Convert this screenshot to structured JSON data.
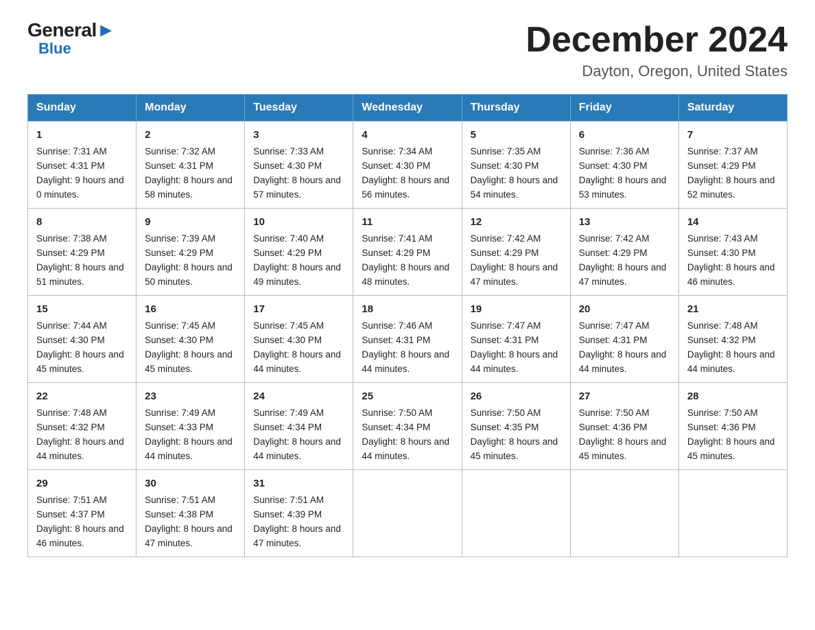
{
  "logo": {
    "general": "General",
    "blue": "Blue",
    "triangle": "▶"
  },
  "header": {
    "month_year": "December 2024",
    "location": "Dayton, Oregon, United States"
  },
  "days_of_week": [
    "Sunday",
    "Monday",
    "Tuesday",
    "Wednesday",
    "Thursday",
    "Friday",
    "Saturday"
  ],
  "weeks": [
    [
      {
        "day": "1",
        "sunrise": "7:31 AM",
        "sunset": "4:31 PM",
        "daylight": "9 hours and 0 minutes."
      },
      {
        "day": "2",
        "sunrise": "7:32 AM",
        "sunset": "4:31 PM",
        "daylight": "8 hours and 58 minutes."
      },
      {
        "day": "3",
        "sunrise": "7:33 AM",
        "sunset": "4:30 PM",
        "daylight": "8 hours and 57 minutes."
      },
      {
        "day": "4",
        "sunrise": "7:34 AM",
        "sunset": "4:30 PM",
        "daylight": "8 hours and 56 minutes."
      },
      {
        "day": "5",
        "sunrise": "7:35 AM",
        "sunset": "4:30 PM",
        "daylight": "8 hours and 54 minutes."
      },
      {
        "day": "6",
        "sunrise": "7:36 AM",
        "sunset": "4:30 PM",
        "daylight": "8 hours and 53 minutes."
      },
      {
        "day": "7",
        "sunrise": "7:37 AM",
        "sunset": "4:29 PM",
        "daylight": "8 hours and 52 minutes."
      }
    ],
    [
      {
        "day": "8",
        "sunrise": "7:38 AM",
        "sunset": "4:29 PM",
        "daylight": "8 hours and 51 minutes."
      },
      {
        "day": "9",
        "sunrise": "7:39 AM",
        "sunset": "4:29 PM",
        "daylight": "8 hours and 50 minutes."
      },
      {
        "day": "10",
        "sunrise": "7:40 AM",
        "sunset": "4:29 PM",
        "daylight": "8 hours and 49 minutes."
      },
      {
        "day": "11",
        "sunrise": "7:41 AM",
        "sunset": "4:29 PM",
        "daylight": "8 hours and 48 minutes."
      },
      {
        "day": "12",
        "sunrise": "7:42 AM",
        "sunset": "4:29 PM",
        "daylight": "8 hours and 47 minutes."
      },
      {
        "day": "13",
        "sunrise": "7:42 AM",
        "sunset": "4:29 PM",
        "daylight": "8 hours and 47 minutes."
      },
      {
        "day": "14",
        "sunrise": "7:43 AM",
        "sunset": "4:30 PM",
        "daylight": "8 hours and 46 minutes."
      }
    ],
    [
      {
        "day": "15",
        "sunrise": "7:44 AM",
        "sunset": "4:30 PM",
        "daylight": "8 hours and 45 minutes."
      },
      {
        "day": "16",
        "sunrise": "7:45 AM",
        "sunset": "4:30 PM",
        "daylight": "8 hours and 45 minutes."
      },
      {
        "day": "17",
        "sunrise": "7:45 AM",
        "sunset": "4:30 PM",
        "daylight": "8 hours and 44 minutes."
      },
      {
        "day": "18",
        "sunrise": "7:46 AM",
        "sunset": "4:31 PM",
        "daylight": "8 hours and 44 minutes."
      },
      {
        "day": "19",
        "sunrise": "7:47 AM",
        "sunset": "4:31 PM",
        "daylight": "8 hours and 44 minutes."
      },
      {
        "day": "20",
        "sunrise": "7:47 AM",
        "sunset": "4:31 PM",
        "daylight": "8 hours and 44 minutes."
      },
      {
        "day": "21",
        "sunrise": "7:48 AM",
        "sunset": "4:32 PM",
        "daylight": "8 hours and 44 minutes."
      }
    ],
    [
      {
        "day": "22",
        "sunrise": "7:48 AM",
        "sunset": "4:32 PM",
        "daylight": "8 hours and 44 minutes."
      },
      {
        "day": "23",
        "sunrise": "7:49 AM",
        "sunset": "4:33 PM",
        "daylight": "8 hours and 44 minutes."
      },
      {
        "day": "24",
        "sunrise": "7:49 AM",
        "sunset": "4:34 PM",
        "daylight": "8 hours and 44 minutes."
      },
      {
        "day": "25",
        "sunrise": "7:50 AM",
        "sunset": "4:34 PM",
        "daylight": "8 hours and 44 minutes."
      },
      {
        "day": "26",
        "sunrise": "7:50 AM",
        "sunset": "4:35 PM",
        "daylight": "8 hours and 45 minutes."
      },
      {
        "day": "27",
        "sunrise": "7:50 AM",
        "sunset": "4:36 PM",
        "daylight": "8 hours and 45 minutes."
      },
      {
        "day": "28",
        "sunrise": "7:50 AM",
        "sunset": "4:36 PM",
        "daylight": "8 hours and 45 minutes."
      }
    ],
    [
      {
        "day": "29",
        "sunrise": "7:51 AM",
        "sunset": "4:37 PM",
        "daylight": "8 hours and 46 minutes."
      },
      {
        "day": "30",
        "sunrise": "7:51 AM",
        "sunset": "4:38 PM",
        "daylight": "8 hours and 47 minutes."
      },
      {
        "day": "31",
        "sunrise": "7:51 AM",
        "sunset": "4:39 PM",
        "daylight": "8 hours and 47 minutes."
      },
      null,
      null,
      null,
      null
    ]
  ]
}
